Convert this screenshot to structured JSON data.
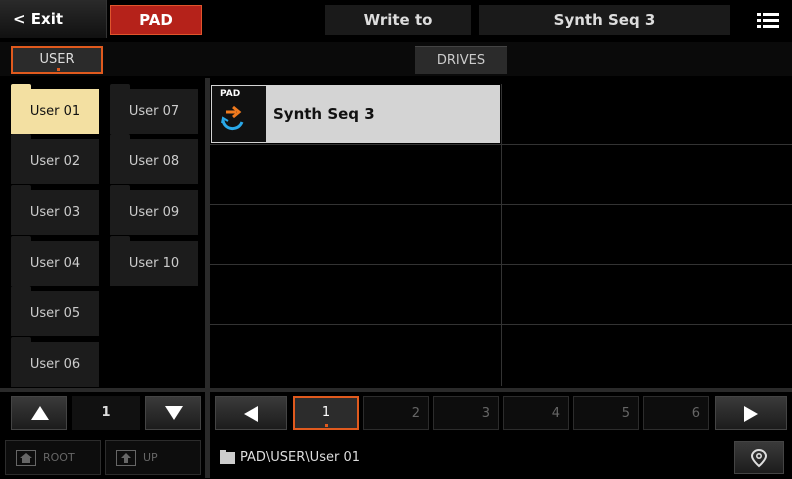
{
  "header": {
    "exit_label": "< Exit",
    "mode_label": "PAD",
    "write_to_label": "Write to",
    "destination_name": "Synth Seq 3"
  },
  "tabs": {
    "user_label": "USER",
    "drives_label": "DRIVES"
  },
  "folders": {
    "items": [
      "User 01",
      "User 02",
      "User 03",
      "User 04",
      "User 05",
      "User 06",
      "User 07",
      "User 08",
      "User 09",
      "User 10"
    ],
    "selected": "User 01"
  },
  "files": [
    {
      "name": "Synth Seq 3",
      "type_tag": "PAD"
    }
  ],
  "left_nav": {
    "page": "1"
  },
  "pages": [
    "1",
    "2",
    "3",
    "4",
    "5",
    "6"
  ],
  "active_page": "1",
  "footer": {
    "root_label": "ROOT",
    "up_label": "UP",
    "path": "PAD\\USER\\User 01"
  },
  "colors": {
    "accent": "#e05a1e",
    "pad_button": "#b5221a",
    "selected_folder": "#f3e0a2",
    "file_item_bg": "#d4d4d4"
  },
  "icons": [
    "menu-icon",
    "pad-loop-icon",
    "up-arrow-icon",
    "down-arrow-icon",
    "left-arrow-icon",
    "right-arrow-icon",
    "home-icon",
    "folder-up-icon",
    "folder-icon",
    "location-pin-icon"
  ]
}
